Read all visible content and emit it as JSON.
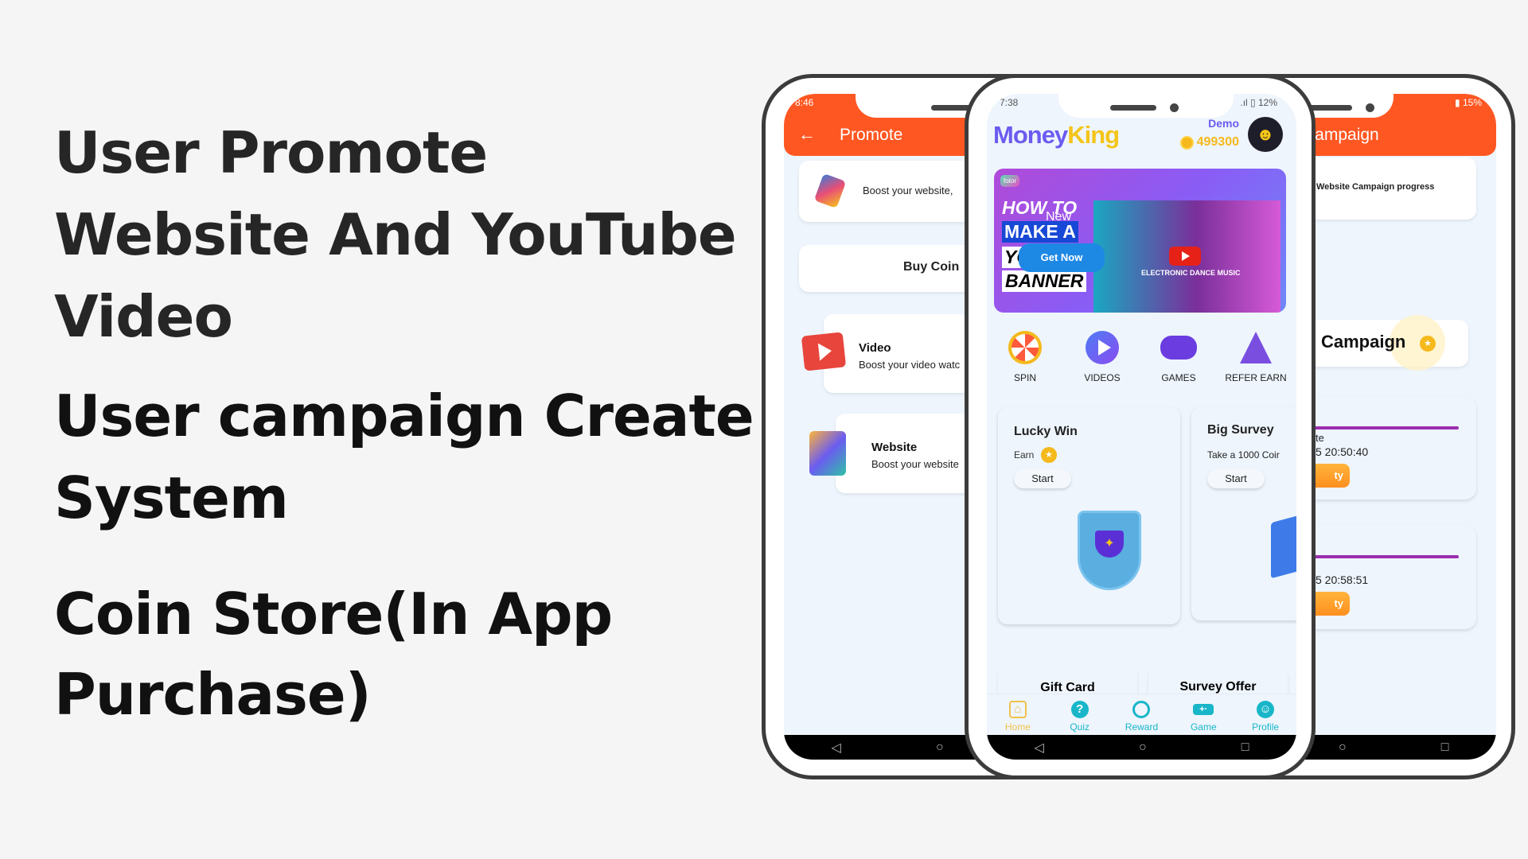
{
  "headlines": [
    "User Promote",
    "Website And YouTube",
    "Video",
    "User campaign Create",
    "System",
    "Coin Store(In App",
    "Purchase)"
  ],
  "colors": {
    "orange": "#ff5722",
    "purple": "#6b5cf0",
    "gold": "#f5c518",
    "teal": "#19b6c9",
    "progress": "#9b2fae"
  },
  "left_phone": {
    "status_time": "8:46",
    "header_title": "Promote",
    "back_icon": "arrow-left-icon",
    "boost_card": "Boost your website,",
    "buy_coin": "Buy Coin",
    "video_title": "Video",
    "video_sub": "Boost your video watc",
    "website_title": "Website",
    "website_sub": "Boost your website"
  },
  "center_phone": {
    "status_time": "7:38",
    "battery": "12%",
    "logo_part1": "Money",
    "logo_part2": "King",
    "user_name": "Demo",
    "coins": "499300",
    "banner": {
      "badge": "fotor",
      "line1": "HOW TO",
      "new": "New",
      "line2": "MAKE A",
      "line3": "YO",
      "line4": "BANNER",
      "cta": "Get Now",
      "video_text": "ELECTRONIC DANCE MUSIC"
    },
    "quick_actions": [
      {
        "label": "SPIN",
        "icon": "spin-wheel-icon"
      },
      {
        "label": "VIDEOS",
        "icon": "video-play-icon"
      },
      {
        "label": "GAMES",
        "icon": "gamepad-icon"
      },
      {
        "label": "REFER EARN",
        "icon": "wizard-icon"
      }
    ],
    "lucky_win": {
      "title": "Lucky Win",
      "earn": "Earn",
      "button": "Start"
    },
    "big_survey": {
      "title": "Big Survey",
      "sub": "Take a 1000 Coir",
      "button": "Start"
    },
    "offers": [
      "Gift Card",
      "Survey Offer"
    ],
    "nav": [
      {
        "label": "Home",
        "icon": "home-icon"
      },
      {
        "label": "Quiz",
        "icon": "question-icon"
      },
      {
        "label": "Reward",
        "icon": "medal-icon"
      },
      {
        "label": "Game",
        "icon": "gamepad-icon"
      },
      {
        "label": "Profile",
        "icon": "profile-icon"
      }
    ]
  },
  "right_phone": {
    "battery": "15%",
    "header_title": "Campaign",
    "progress_card": "Website Campaign progress",
    "campaign_banner": "Campaign",
    "campaigns": [
      {
        "label": "te",
        "date": "5 20:50:40",
        "button": "ty",
        "progress": 100
      },
      {
        "label": "",
        "date": "5 20:58:51",
        "button": "ty",
        "progress": 100
      }
    ]
  }
}
